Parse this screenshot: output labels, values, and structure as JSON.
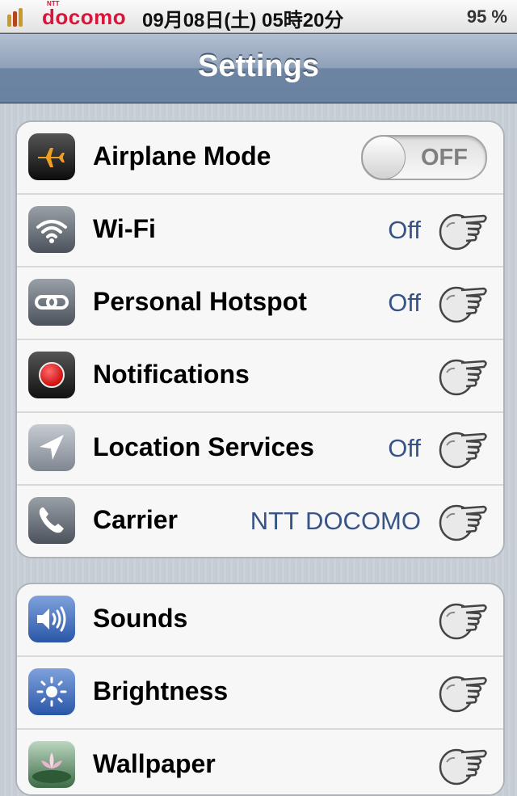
{
  "status_bar": {
    "carrier_small": "NTT",
    "carrier": "docomo",
    "datetime": "09月08日(土) 05時20分",
    "battery": "95 %"
  },
  "nav": {
    "title": "Settings"
  },
  "group1": [
    {
      "label": "Airplane Mode",
      "icon": "airplane-icon",
      "toggle": "OFF"
    },
    {
      "label": "Wi-Fi",
      "icon": "wifi-icon",
      "value": "Off"
    },
    {
      "label": "Personal Hotspot",
      "icon": "hotspot-icon",
      "value": "Off"
    },
    {
      "label": "Notifications",
      "icon": "notifications-icon",
      "value": ""
    },
    {
      "label": "Location Services",
      "icon": "location-icon",
      "value": "Off"
    },
    {
      "label": "Carrier",
      "icon": "phone-icon",
      "value": "NTT DOCOMO"
    }
  ],
  "group2": [
    {
      "label": "Sounds",
      "icon": "speaker-icon"
    },
    {
      "label": "Brightness",
      "icon": "brightness-icon"
    },
    {
      "label": "Wallpaper",
      "icon": "flower-icon"
    }
  ],
  "colors": {
    "value_text": "#385487",
    "nav_bar": "#6d84a2",
    "docomo_red": "#d9153a"
  }
}
